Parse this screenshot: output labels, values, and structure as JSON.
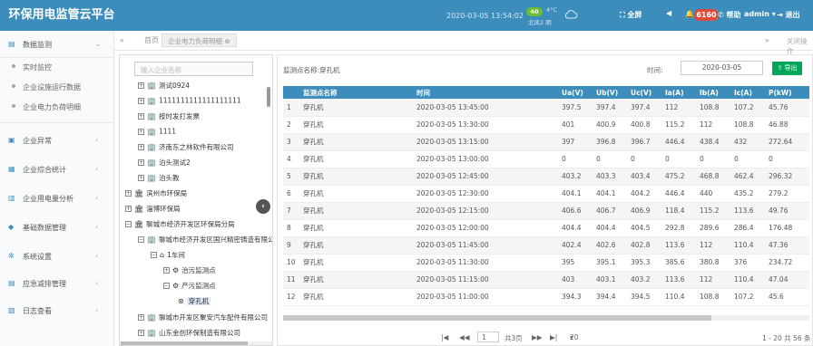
{
  "header": {
    "app_title": "环保用电监管云平台",
    "datetime": "2020-03-05 13:54:02",
    "aqi": "40",
    "temperature": "4°C",
    "wind": "北风2  阴",
    "fullscreen_label": "全屏",
    "alert_count": "6160",
    "help_label": "帮助",
    "user_label": "admin",
    "logout_label": "退出"
  },
  "sidebar": {
    "items": [
      {
        "label": "数据监测",
        "icon": "monitor-icon"
      },
      {
        "label": "企业异常",
        "icon": "warning-icon"
      },
      {
        "label": "企业综合统计",
        "icon": "stats-icon"
      },
      {
        "label": "企业用电量分析",
        "icon": "chart-icon"
      },
      {
        "label": "基础数据管理",
        "icon": "database-icon"
      },
      {
        "label": "系统设置",
        "icon": "gear-icon"
      },
      {
        "label": "应急减排管理",
        "icon": "emergency-icon"
      },
      {
        "label": "日志查看",
        "icon": "log-icon"
      }
    ],
    "subitems": [
      "实时监控",
      "企业设施运行数据",
      "企业电力负荷明细"
    ]
  },
  "tabs": {
    "home_label": "首页",
    "active_tab": "企业电力负荷明细",
    "close_ops": "关闭操作"
  },
  "tree": {
    "search_placeholder": "输入企业名称",
    "nodes": [
      {
        "label": "测试0924"
      },
      {
        "label": "1111111111111111111"
      },
      {
        "label": "按时发打发票"
      },
      {
        "label": "1111"
      },
      {
        "label": "济南东之林软件有限公司"
      },
      {
        "label": "泊头测试2"
      },
      {
        "label": "泊头教"
      },
      {
        "label": "滨州市环保局"
      },
      {
        "label": "淄博环保局"
      },
      {
        "label": "聊城市经济开发区环保局分局"
      },
      {
        "label": "聊城市经济开发区国兴精密铸造有限公司"
      },
      {
        "label": "1车间"
      },
      {
        "label": "治污监测点"
      },
      {
        "label": "产污监测点"
      },
      {
        "label": "穿孔机"
      },
      {
        "label": "聊城市开发区聚安汽车配件有限公司"
      },
      {
        "label": "山东金创环保制造有限公司"
      }
    ]
  },
  "main": {
    "title": "监测点名称:穿孔机",
    "time_label": "时间:",
    "date_value": "2020-03-05",
    "export_label": "导出",
    "columns": [
      "",
      "监测点名称",
      "时间",
      "Ua(V)",
      "Ub(V)",
      "Uc(V)",
      "Ia(A)",
      "Ib(A)",
      "Ic(A)",
      "P(kW)"
    ],
    "rows": [
      [
        "1",
        "穿孔机",
        "2020-03-05 13:45:00",
        "397.5",
        "397.4",
        "397.4",
        "112",
        "108.8",
        "107.2",
        "45.76"
      ],
      [
        "2",
        "穿孔机",
        "2020-03-05 13:30:00",
        "401",
        "400.9",
        "400.8",
        "115.2",
        "112",
        "108.8",
        "46.88"
      ],
      [
        "3",
        "穿孔机",
        "2020-03-05 13:15:00",
        "397",
        "396.8",
        "396.7",
        "446.4",
        "438.4",
        "432",
        "272.64"
      ],
      [
        "4",
        "穿孔机",
        "2020-03-05 13:00:00",
        "0",
        "0",
        "0",
        "0",
        "0",
        "0",
        "0"
      ],
      [
        "5",
        "穿孔机",
        "2020-03-05 12:45:00",
        "403.2",
        "403.3",
        "403.4",
        "475.2",
        "468.8",
        "462.4",
        "296.32"
      ],
      [
        "6",
        "穿孔机",
        "2020-03-05 12:30:00",
        "404.1",
        "404.1",
        "404.2",
        "446.4",
        "440",
        "435.2",
        "279.2"
      ],
      [
        "7",
        "穿孔机",
        "2020-03-05 12:15:00",
        "406.6",
        "406.7",
        "406.9",
        "118.4",
        "115.2",
        "113.6",
        "49.76"
      ],
      [
        "8",
        "穿孔机",
        "2020-03-05 12:00:00",
        "404.4",
        "404.4",
        "404.5",
        "292.8",
        "289.6",
        "286.4",
        "176.48"
      ],
      [
        "9",
        "穿孔机",
        "2020-03-05 11:45:00",
        "402.4",
        "402.6",
        "402.8",
        "113.6",
        "112",
        "110.4",
        "47.36"
      ],
      [
        "10",
        "穿孔机",
        "2020-03-05 11:30:00",
        "395",
        "395.1",
        "395.3",
        "385.6",
        "380.8",
        "376",
        "234.72"
      ],
      [
        "11",
        "穿孔机",
        "2020-03-05 11:15:00",
        "403",
        "403.1",
        "403.2",
        "113.6",
        "112",
        "110.4",
        "47.04"
      ],
      [
        "12",
        "穿孔机",
        "2020-03-05 11:00:00",
        "394.3",
        "394.4",
        "394.5",
        "110.4",
        "108.8",
        "107.2",
        "45.6"
      ]
    ],
    "pager": {
      "page_input": "1",
      "total_pages": "共3页",
      "page_size": "20",
      "summary": "1 - 20 共 56 条"
    }
  }
}
